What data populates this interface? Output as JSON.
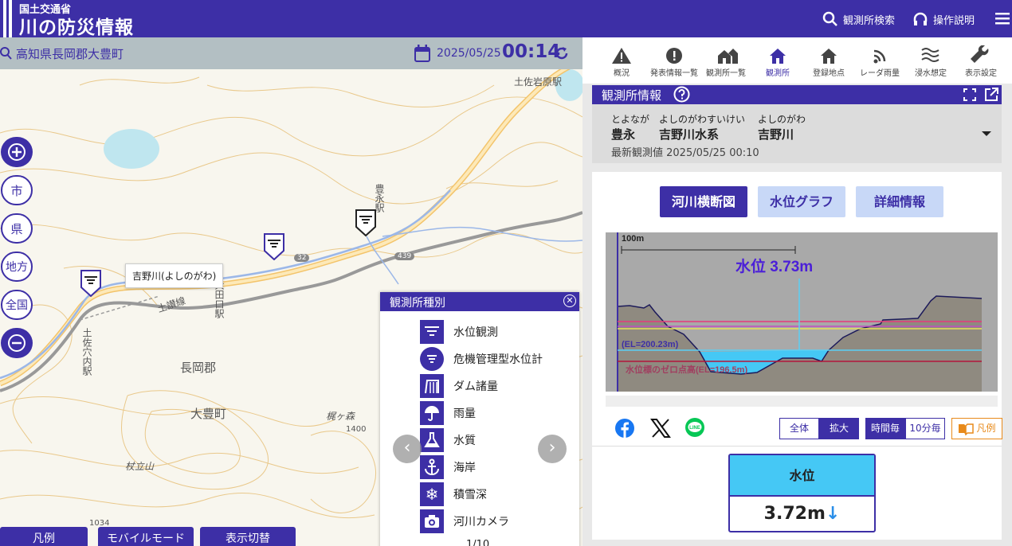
{
  "header": {
    "org": "国土交通省",
    "title": "川の防災情報",
    "station_search": "観測所検索",
    "manual": "操作説明"
  },
  "map": {
    "location": "高知県長岡郡大豊町",
    "date": "2025/05/25",
    "time": "00:14",
    "level_buttons": [
      "市",
      "県",
      "地方",
      "全国"
    ],
    "labels": {
      "station_toyonaga": "豊永駅",
      "station_tosaiwahara": "土佐岩原駅",
      "station_oda": "大田口駅",
      "station_tosaanai": "土佐穴内駅",
      "district": "長岡郡",
      "town": "大豊町",
      "line": "土讃線",
      "mountain_a": "梶ヶ森",
      "mountain_a_elev": "1400",
      "mountain_b": "杖立山",
      "elev_c": "1034",
      "route_32": "32",
      "route_439": "439"
    },
    "callout": "吉野川(よしのがわ)",
    "bottom_buttons": [
      "凡例",
      "モバイルモード",
      "表示切替"
    ]
  },
  "legend": {
    "title": "観測所種別",
    "items": [
      {
        "label": "水位観測",
        "icon": "water-level-icon"
      },
      {
        "label": "危機管理型水位計",
        "icon": "crisis-gauge-icon"
      },
      {
        "label": "ダム諸量",
        "icon": "dam-icon"
      },
      {
        "label": "雨量",
        "icon": "umbrella-icon"
      },
      {
        "label": "水質",
        "icon": "flask-icon"
      },
      {
        "label": "海岸",
        "icon": "anchor-icon"
      },
      {
        "label": "積雪深",
        "icon": "snowflake-icon"
      },
      {
        "label": "河川カメラ",
        "icon": "camera-icon"
      }
    ],
    "page": "1/10"
  },
  "nav": {
    "items": [
      "概況",
      "発表情報一覧",
      "観測所一覧",
      "観測所",
      "登録地点",
      "レーダ雨量",
      "浸水想定",
      "表示設定"
    ],
    "active": "観測所"
  },
  "station_info": {
    "section_title": "観測所情報",
    "ruby": [
      "とよなが",
      "よしのがわすいけい",
      "よしのがわ"
    ],
    "names": [
      "豊永",
      "吉野川水系",
      "吉野川"
    ],
    "latest": "最新観測値 2025/05/25 00:10"
  },
  "panel": {
    "tabs": [
      "河川横断図",
      "水位グラフ",
      "詳細情報"
    ],
    "cross_section": {
      "scale_label": "100m",
      "water_level_label": "水位 3.73m",
      "el_label": "(EL=200.23m)",
      "zero_label": "水位標のゼロ点高(EL=196.5m)"
    },
    "zoom": [
      "全体",
      "拡大"
    ],
    "interval": [
      "時間毎",
      "10分毎"
    ],
    "legend_button": "凡例",
    "water_level_head": "水位",
    "water_level_value": "3.72m"
  },
  "colors": {
    "brand": "#3d2fa6",
    "tab_inactive": "#c8d8f7",
    "water": "#45c8f5"
  }
}
